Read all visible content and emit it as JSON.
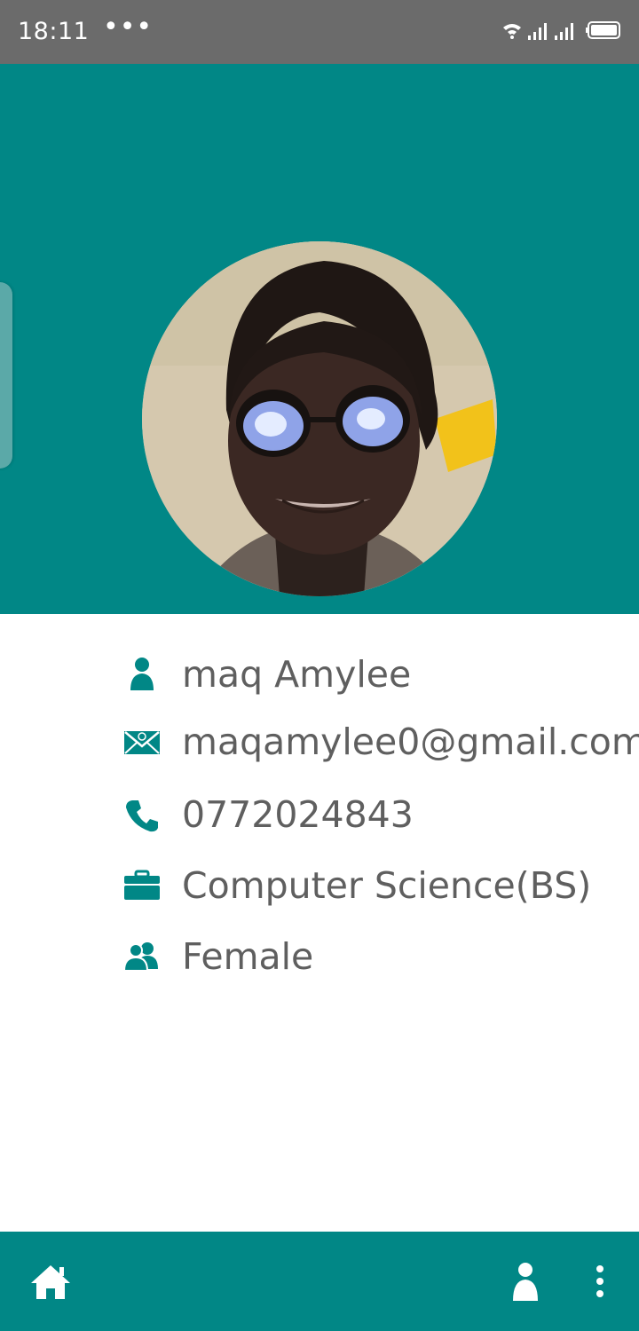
{
  "status_bar": {
    "time": "18:11",
    "dots": "•••",
    "icons": [
      "wifi-icon",
      "signal-icon",
      "signal-icon",
      "battery-icon"
    ]
  },
  "theme": {
    "primary": "#018786",
    "status_bar_bg": "#6b6b6b",
    "text": "#5f5f5f",
    "background": "#ffffff"
  },
  "profile": {
    "avatar": "profile-photo",
    "name": "maq Amylee",
    "email": "maqamylee0@gmail.com",
    "phone": "0772024843",
    "course": "Computer Science(BS)",
    "gender": "Female"
  },
  "info_icons": {
    "name": "person-icon",
    "email": "email-icon",
    "phone": "phone-icon",
    "course": "briefcase-icon",
    "gender": "people-icon"
  },
  "bottom_nav": {
    "items": [
      "home-icon",
      "profile-icon",
      "more-vertical-icon"
    ]
  }
}
